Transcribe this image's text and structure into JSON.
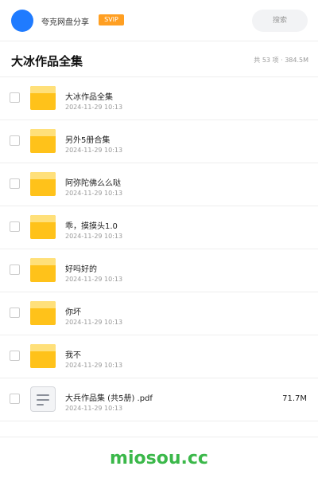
{
  "header": {
    "brand": "夸克网盘分享",
    "badge": "SVIP",
    "search_placeholder": "搜索"
  },
  "folder": {
    "title": "大冰作品全集",
    "meta": "共 53 项 · 384.5M"
  },
  "items": [
    {
      "name": "大冰作品全集",
      "date": "2024-11-29 10:13",
      "type": "folder"
    },
    {
      "name": "另外5册合集",
      "date": "2024-11-29 10:13",
      "type": "folder"
    },
    {
      "name": "阿弥陀佛么么哒",
      "date": "2024-11-29 10:13",
      "type": "folder"
    },
    {
      "name": "乖，摸摸头1.0",
      "date": "2024-11-29 10:13",
      "type": "folder"
    },
    {
      "name": "好吗好的",
      "date": "2024-11-29 10:13",
      "type": "folder"
    },
    {
      "name": "你坏",
      "date": "2024-11-29 10:13",
      "type": "folder"
    },
    {
      "name": "我不",
      "date": "2024-11-29 10:13",
      "type": "folder"
    },
    {
      "name": "大兵作品集 (共5册) .pdf",
      "date": "2024-11-29 10:13",
      "type": "file",
      "size": "71.7M"
    }
  ],
  "footer": {
    "watermark": "miosou.cc"
  },
  "colors": {
    "brand_blue": "#1f7bff",
    "svip_orange": "#ff9f22",
    "folder_yellow": "#ffc21a",
    "watermark_green": "#3bb84a"
  }
}
